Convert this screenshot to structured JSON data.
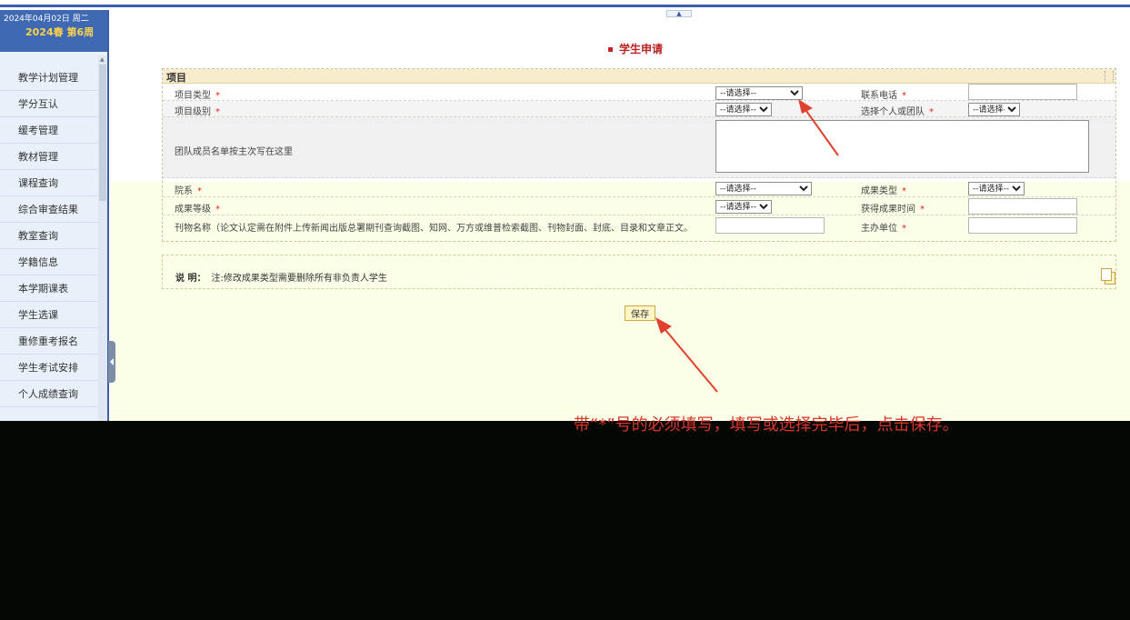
{
  "header": {
    "date": "2024年04月02日 周二",
    "term": "2024春 第6周",
    "collapse_glyph": "▲"
  },
  "sidebar": {
    "items": [
      {
        "label": "教学计划管理"
      },
      {
        "label": "学分互认"
      },
      {
        "label": "缓考管理"
      },
      {
        "label": "教材管理"
      },
      {
        "label": "课程查询"
      },
      {
        "label": "综合审查结果"
      },
      {
        "label": "教室查询"
      },
      {
        "label": "学籍信息"
      },
      {
        "label": "本学期课表"
      },
      {
        "label": "学生选课"
      },
      {
        "label": "重修重考报名"
      },
      {
        "label": "学生考试安排"
      },
      {
        "label": "个人成绩查询"
      }
    ]
  },
  "page": {
    "title": "学生申请"
  },
  "form": {
    "section_title": "项目",
    "project_type": {
      "label": "项目类型",
      "value": "--请选择--"
    },
    "phone": {
      "label": "联系电话"
    },
    "project_level": {
      "label": "项目级别",
      "value": "--请选择--"
    },
    "individual_team": {
      "label": "选择个人或团队",
      "value": "--请选择--"
    },
    "team_members": {
      "label": "团队成员名单按主次写在这里"
    },
    "department": {
      "label": "院系",
      "value": "--请选择--"
    },
    "result_type": {
      "label": "成果类型",
      "value": "--请选择--"
    },
    "result_grade": {
      "label": "成果等级",
      "value": "--请选择--"
    },
    "result_time": {
      "label": "获得成果时间"
    },
    "journal": {
      "label": "刊物名称（论文认定需在附件上传新闻出版总署期刊查询截图、知网、万方或维普检索截图、刊物封面、封底、目录和文章正文。"
    },
    "organizer": {
      "label": "主办单位"
    },
    "required_mark": "*"
  },
  "note": {
    "prefix": "说 明：",
    "text": "注:修改成果类型需要删除所有非负责人学生"
  },
  "actions": {
    "save_label": "保存"
  },
  "annotation": {
    "text": "带“*”号的必须填写，填写或选择完毕后，点击保存。"
  },
  "colors": {
    "accent": "#3a5fa8",
    "required": "#e02020",
    "annotation": "#d9362b",
    "overlay": "#040804"
  }
}
